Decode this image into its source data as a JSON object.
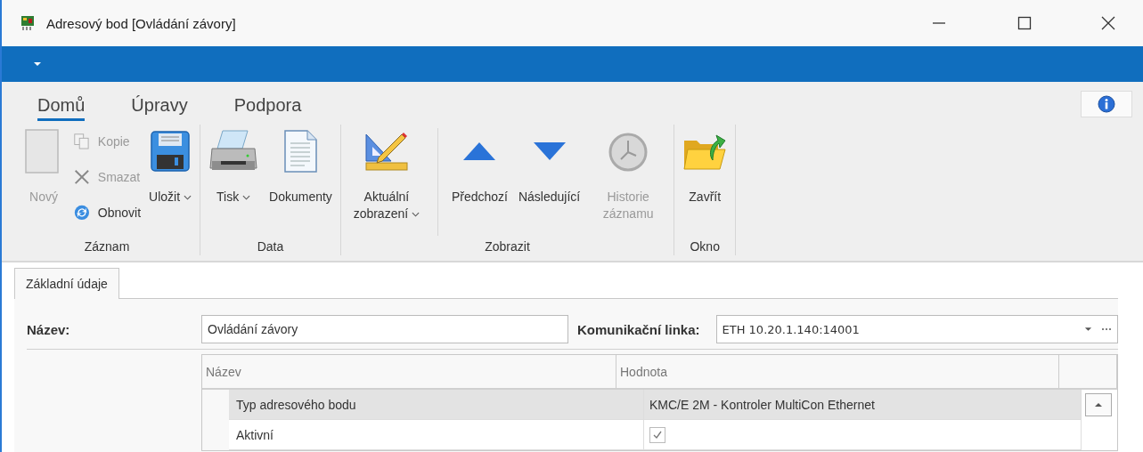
{
  "window": {
    "title": "Adresový bod [Ovládání závory]"
  },
  "ribbon": {
    "tabs": [
      {
        "label": "Domů",
        "selected": true
      },
      {
        "label": "Úpravy",
        "selected": false
      },
      {
        "label": "Podpora",
        "selected": false
      }
    ],
    "groups": [
      {
        "label": "Záznam",
        "items": [
          {
            "kind": "large",
            "label": "Nový",
            "disabled": true,
            "dropdown": false
          },
          {
            "kind": "small",
            "label": "Kopie",
            "disabled": true
          },
          {
            "kind": "small",
            "label": "Smazat",
            "disabled": true
          },
          {
            "kind": "small",
            "label": "Obnovit",
            "disabled": false
          },
          {
            "kind": "large",
            "label": "Uložit",
            "disabled": false,
            "dropdown": true
          }
        ]
      },
      {
        "label": "Data",
        "items": [
          {
            "kind": "large",
            "label": "Tisk",
            "disabled": false,
            "dropdown": true
          },
          {
            "kind": "large",
            "label": "Dokumenty",
            "disabled": false,
            "dropdown": false
          }
        ]
      },
      {
        "label": "Zobrazit",
        "items": [
          {
            "kind": "large",
            "label": "Aktuální zobrazení",
            "disabled": false,
            "dropdown": true
          },
          {
            "kind": "separator"
          },
          {
            "kind": "large",
            "label": "Předchozí",
            "disabled": false,
            "dropdown": false
          },
          {
            "kind": "large",
            "label": "Následující",
            "disabled": false,
            "dropdown": false
          },
          {
            "kind": "large",
            "label": "Historie záznamu",
            "disabled": true,
            "dropdown": false
          }
        ]
      },
      {
        "label": "Okno",
        "items": [
          {
            "kind": "large",
            "label": "Zavřít",
            "disabled": false,
            "dropdown": false
          }
        ]
      }
    ]
  },
  "page_tabs": [
    {
      "label": "Základní údaje",
      "selected": true
    }
  ],
  "form": {
    "name_label": "Název:",
    "name_value": "Ovládání závory",
    "link_label": "Komunikační linka:",
    "link_value": "ETH 10.20.1.140:14001"
  },
  "table": {
    "columns": [
      "Název",
      "Hodnota"
    ],
    "rows": [
      {
        "kind": "text",
        "name": "Typ adresového bodu",
        "value": "KMC/E 2M - Kontroler MultiCon Ethernet",
        "selected": true
      },
      {
        "kind": "checkbox",
        "name": "Aktivní",
        "checked": true,
        "selected": false
      }
    ]
  }
}
